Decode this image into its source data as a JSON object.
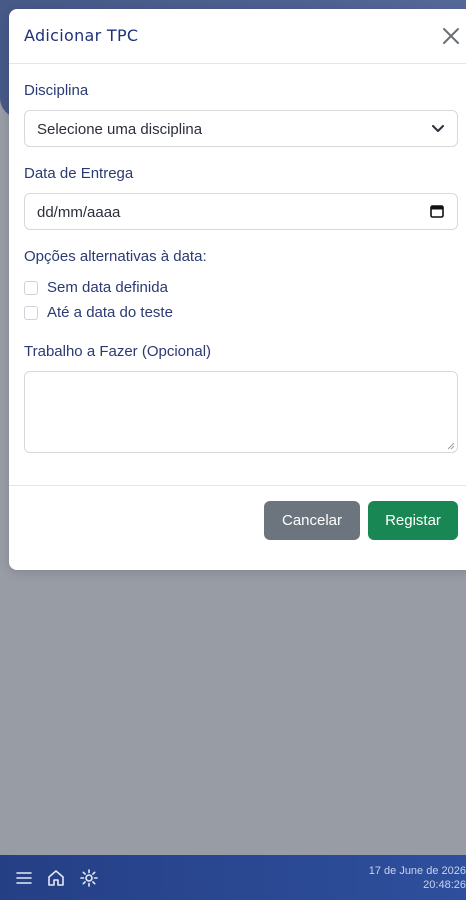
{
  "modal": {
    "title": "Adicionar TPC",
    "discipline_label": "Disciplina",
    "discipline_value": "Selecione uma disciplina",
    "date_label": "Data de Entrega",
    "date_placeholder": "dd/mm/aaaa",
    "alt_label": "Opções alternativas à data:",
    "options": [
      {
        "label": "Sem data definida",
        "checked": false
      },
      {
        "label": "Até a data do teste",
        "checked": false
      }
    ],
    "work_label": "Trabalho a Fazer (Opcional)",
    "work_value": "",
    "cancel_label": "Cancelar",
    "save_label": "Registar"
  },
  "taskbar": {
    "icons": [
      "menu-icon",
      "home-icon",
      "gear-icon"
    ],
    "date": "17 de June de 2026",
    "time": "20:48:26"
  },
  "colors": {
    "primary": "#1f3278",
    "cancel": "#6c757d",
    "save": "#198754",
    "taskbar": "#253f85"
  }
}
